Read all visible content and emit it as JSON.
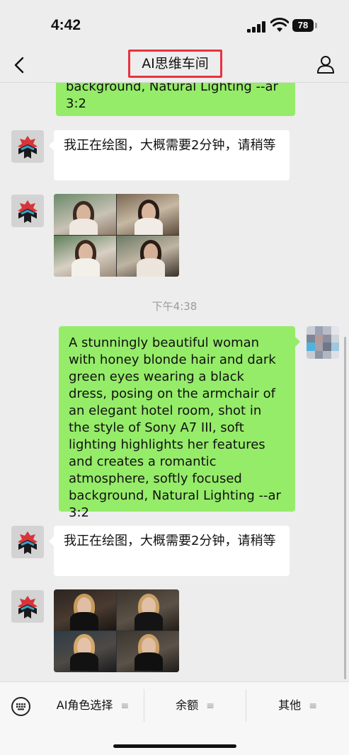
{
  "status_bar": {
    "time": "4:42",
    "battery": "78"
  },
  "nav": {
    "title": "AI思维车间"
  },
  "messages": [
    {
      "side": "user",
      "text": "background, Natural Lighting --ar 3:2"
    },
    {
      "side": "bot",
      "text": "我正在绘图，大概需要2分钟，请稍等"
    },
    {
      "side": "bot",
      "type": "image-grid",
      "description": "4 portrait renders"
    },
    {
      "side": "user",
      "text": "A stunningly beautiful woman with honey blonde hair and dark green eyes wearing a black dress, posing on the armchair of an elegant hotel room, shot in the style of Sony A7 III, soft lighting highlights her features and creates a romantic atmosphere, softly focused background, Natural Lighting --ar 3:2"
    },
    {
      "side": "bot",
      "text": "我正在绘图，大概需要2分钟，请稍等"
    },
    {
      "side": "bot",
      "type": "image-grid"
    }
  ],
  "chat": {
    "partial_user_line1": "background, Natural Lighting --ar",
    "partial_user_line2": "3:2",
    "bot_reply_1": "我正在绘图，大概需要2分钟，请稍等",
    "timestamp": "下午4:38",
    "user_prompt": "A stunningly beautiful woman with honey blonde hair and dark green eyes wearing a black dress, posing on the armchair of an elegant hotel room, shot in the style of Sony A7 III, soft lighting highlights her features and creates a romantic atmosphere, softly focused background, Natural Lighting --ar 3:2",
    "bot_reply_2": "我正在绘图，大概需要2分钟，请稍等"
  },
  "menu": {
    "item1": "AI角色选择",
    "item2": "余额",
    "item3": "其他",
    "menu_glyph": "≡"
  },
  "colors": {
    "user_bubble": "#95ec69",
    "bot_bubble": "#ffffff",
    "background": "#ededed",
    "highlight_box": "#e8323f"
  },
  "icons": [
    "back-chevron-icon",
    "profile-icon",
    "keyboard-icon",
    "wifi-icon",
    "signal-icon",
    "battery-icon"
  ]
}
